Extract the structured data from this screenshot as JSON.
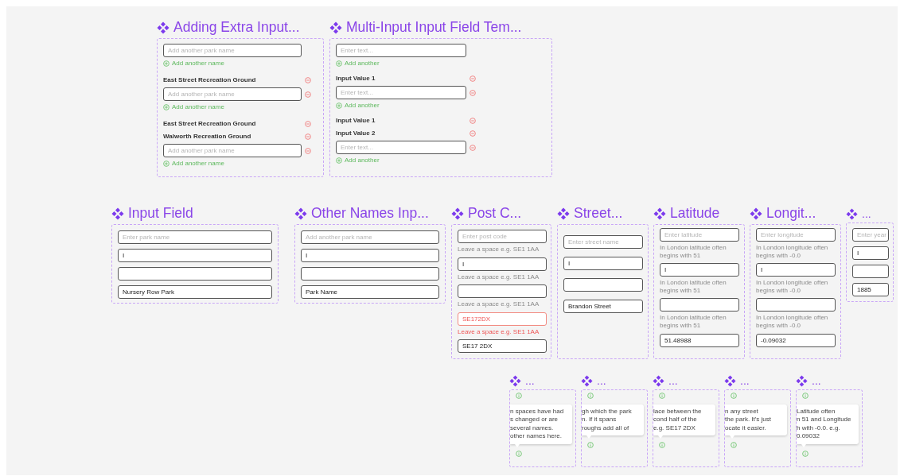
{
  "sets": [
    {
      "title": "Adding Extra Input...",
      "variants": [
        {
          "rows": [
            {
              "kind": "field",
              "placeholder": "Add another park name",
              "removable": false
            },
            {
              "kind": "add",
              "label": "Add another name"
            }
          ]
        },
        {
          "rows": [
            {
              "kind": "entry",
              "label": "East Street Recreation Ground"
            },
            {
              "kind": "field",
              "placeholder": "Add another park name",
              "removable": true
            },
            {
              "kind": "add",
              "label": "Add another name"
            }
          ]
        },
        {
          "rows": [
            {
              "kind": "entry",
              "label": "East Street Recreation Ground"
            },
            {
              "kind": "entry",
              "label": "Walworth Recreation Ground"
            },
            {
              "kind": "field",
              "placeholder": "Add another park name",
              "removable": true
            },
            {
              "kind": "add",
              "label": "Add another name"
            }
          ]
        }
      ]
    },
    {
      "title": "Multi-Input Input Field Tem...",
      "variants": [
        {
          "rows": [
            {
              "kind": "field",
              "placeholder": "Enter text...",
              "removable": false
            },
            {
              "kind": "add",
              "label": "Add another"
            }
          ]
        },
        {
          "rows": [
            {
              "kind": "entry",
              "label": "Input Value 1"
            },
            {
              "kind": "field",
              "placeholder": "Enter text...",
              "removable": true
            },
            {
              "kind": "add",
              "label": "Add another"
            }
          ]
        },
        {
          "rows": [
            {
              "kind": "entry",
              "label": "Input Value 1"
            },
            {
              "kind": "entry",
              "label": "Input Value 2"
            },
            {
              "kind": "field",
              "placeholder": "Enter text...",
              "removable": true
            },
            {
              "kind": "add",
              "label": "Add another"
            }
          ]
        }
      ]
    },
    {
      "title": "Input Field",
      "variants": [
        {
          "rows": [
            {
              "kind": "field",
              "placeholder": "Enter park name"
            }
          ]
        },
        {
          "rows": [
            {
              "kind": "field",
              "value": "I"
            }
          ]
        },
        {
          "rows": [
            {
              "kind": "field"
            }
          ]
        },
        {
          "rows": [
            {
              "kind": "field",
              "value": "Nursery Row Park"
            }
          ]
        }
      ]
    },
    {
      "title": "Other Names Inp...",
      "variants": [
        {
          "rows": [
            {
              "kind": "field",
              "placeholder": "Add another park name"
            }
          ]
        },
        {
          "rows": [
            {
              "kind": "field",
              "value": "I"
            }
          ]
        },
        {
          "rows": [
            {
              "kind": "field"
            }
          ]
        },
        {
          "rows": [
            {
              "kind": "field",
              "value": "Park Name"
            }
          ]
        }
      ]
    },
    {
      "title": "Post C...",
      "variants": [
        {
          "rows": [
            {
              "kind": "field",
              "placeholder": "Enter post code",
              "error": false
            },
            {
              "kind": "hint",
              "text": "Leave a space e.g. SE1 1AA",
              "error": false
            }
          ]
        },
        {
          "rows": [
            {
              "kind": "field",
              "value": "I",
              "error": false
            },
            {
              "kind": "hint",
              "text": "Leave a space e.g. SE1 1AA",
              "error": false
            }
          ]
        },
        {
          "rows": [
            {
              "kind": "field",
              "error": false
            },
            {
              "kind": "hint",
              "text": "Leave a space e.g. SE1 1AA",
              "error": false
            }
          ]
        },
        {
          "rows": [
            {
              "kind": "field",
              "value": "SE172DX",
              "error": true
            },
            {
              "kind": "hint",
              "text": "Leave a space e.g. SE1 1AA",
              "error": true
            }
          ]
        },
        {
          "rows": [
            {
              "kind": "field",
              "value": "SE17 2DX",
              "error": false
            }
          ]
        }
      ]
    },
    {
      "title": "Street...",
      "variants": [
        {
          "rows": [
            {
              "kind": "field",
              "placeholder": "Enter street name"
            }
          ]
        },
        {
          "rows": [
            {
              "kind": "field",
              "value": "I"
            }
          ]
        },
        {
          "rows": [
            {
              "kind": "field"
            }
          ]
        },
        {
          "rows": [
            {
              "kind": "field",
              "value": "Brandon Street"
            }
          ]
        }
      ]
    },
    {
      "title": "Latitude",
      "variants": [
        {
          "rows": [
            {
              "kind": "field",
              "placeholder": "Enter latitude"
            },
            {
              "kind": "hint",
              "text": "In London latitude often begins with 51"
            }
          ]
        },
        {
          "rows": [
            {
              "kind": "field",
              "value": "I"
            },
            {
              "kind": "hint",
              "text": "In London latitude often begins with 51"
            }
          ]
        },
        {
          "rows": [
            {
              "kind": "field"
            },
            {
              "kind": "hint",
              "text": "In London latitude often begins with 51"
            }
          ]
        },
        {
          "rows": [
            {
              "kind": "field",
              "value": "51.48988"
            }
          ]
        }
      ]
    },
    {
      "title": "Longit...",
      "variants": [
        {
          "rows": [
            {
              "kind": "field",
              "placeholder": "Enter longitude"
            },
            {
              "kind": "hint",
              "text": "In London longitude often begins with -0.0"
            }
          ]
        },
        {
          "rows": [
            {
              "kind": "field",
              "value": "I"
            },
            {
              "kind": "hint",
              "text": "In London longitude often begins with -0.0"
            }
          ]
        },
        {
          "rows": [
            {
              "kind": "field"
            },
            {
              "kind": "hint",
              "text": "In  London longitude often begins with -0.0"
            }
          ]
        },
        {
          "rows": [
            {
              "kind": "field",
              "value": "-0.09032"
            }
          ]
        }
      ]
    },
    {
      "title": "...",
      "variants": [
        {
          "rows": [
            {
              "kind": "field",
              "placeholder": "Enter year"
            }
          ]
        },
        {
          "rows": [
            {
              "kind": "field",
              "value": "I"
            }
          ]
        },
        {
          "rows": [
            {
              "kind": "field"
            }
          ]
        },
        {
          "rows": [
            {
              "kind": "field",
              "value": "1885"
            }
          ]
        }
      ]
    },
    {
      "title": "...",
      "variants": [
        {
          "rows": [
            {
              "kind": "tooltip",
              "text": "n spaces have had\ns changed or are\nseveral names.\nother names here."
            }
          ]
        }
      ]
    },
    {
      "title": "...",
      "variants": [
        {
          "rows": [
            {
              "kind": "tooltip",
              "text": "gh which the park\nn. If it spans\nroughs add all of"
            }
          ]
        }
      ]
    },
    {
      "title": "...",
      "variants": [
        {
          "rows": [
            {
              "kind": "tooltip",
              "text": "lace between the\ncond half of the\ne.g. SE17 2DX"
            }
          ]
        }
      ]
    },
    {
      "title": "...",
      "variants": [
        {
          "rows": [
            {
              "kind": "tooltip",
              "text": "n any street\nthe park. It's just\nocate it easier."
            }
          ]
        }
      ]
    },
    {
      "title": "...",
      "variants": [
        {
          "rows": [
            {
              "kind": "tooltip",
              "text": "Latitude often\nn 51 and Longitude\nh with -0.0. e.g.\n0.09032"
            }
          ]
        }
      ]
    }
  ]
}
